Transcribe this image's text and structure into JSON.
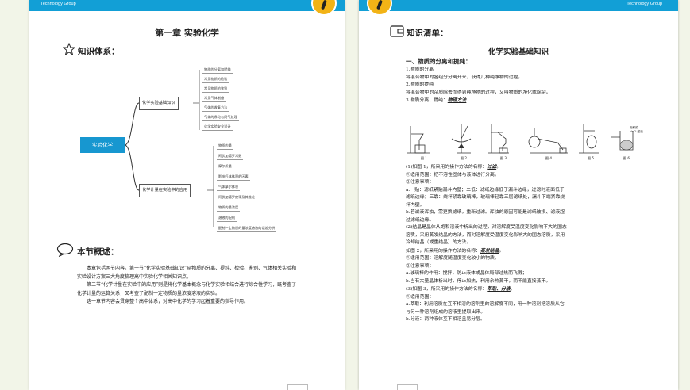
{
  "brand": "Technology Group",
  "left": {
    "chapter_title": "第一章  实验化学",
    "knowledge_heading": "知识体系：",
    "mindmap": {
      "root": "实验化学",
      "branch1": {
        "label": "化学实验基础知识",
        "leaves": [
          "物质的分离和提纯",
          "常见物质的检验",
          "常见物质的鉴别",
          "常见气体制备",
          "气体的收集方法",
          "气体的净化与尾气处理",
          "化学实验安全设计"
        ]
      },
      "branch2": {
        "label": "化学计量在实验中的应用",
        "leaves": [
          "物质的量",
          "阿伏加德罗常数",
          "摩尔质量",
          "影响气体体积的因素",
          "气体摩尔体积",
          "阿伏加德罗定律及其推论",
          "物质的量浓度",
          "溶液的配制",
          "配制一定物质的量浓度溶液的误差分析"
        ]
      }
    },
    "overview_heading": "本节概述：",
    "overview": [
      "本章包括两节内容。第一节“化学实验基础知识”从物质的分离、提纯、检验、鉴别、气体相关实验和实验设计方案三大角度梳理高中实验化学相关知识点。",
      "第二节“化学计量在实验中的应用”则是将化学基本概念与化学实验相结合进行综合性学习，既考查了化学计量的运算关系，又考查了配制一定物质的量浓度溶液的实验。",
      "这一章节内容会贯穿整个高中体系，对高中化学的学习起着重要的指导作用。"
    ]
  },
  "right": {
    "list_heading": "知识清单：",
    "doc_title": "化学实验基础知识",
    "section1": "一、物质的分离和提纯：",
    "lines": [
      "1.物质的分离",
      "将混合物中的各组分分离开来，获得几种纯净物的过程。",
      "2.物质的提纯",
      "将混合物中的杂质除去而得到纯净物的过程，又叫物质的净化或除杂。",
      "3.物质分离、提纯："
    ],
    "method_label": "物理方法",
    "figures": [
      "图 1",
      "图 2",
      "图 3",
      "图 4",
      "图 5",
      "图 6"
    ],
    "fig6_label": "饱和的 NaCl 溶液",
    "fig1_prefix": "(1)如图 1，所采用的操作方法的名称：",
    "fig1_method": "过滤",
    "fig1_lines": [
      "①适用范围：把不溶性固体与液体进行分离。",
      "②注意事项：",
      "a.一贴：滤纸紧贴漏斗内壁；二低：滤纸边缘低于漏斗边缘，过滤时液面低于",
      "滤纸边缘；三靠：烧杯紧靠玻璃棒，玻璃棒轻靠三层滤纸处，漏斗下端紧靠烧",
      "杯内壁。",
      "b.若滤液浑浊，需更换滤纸，重新过滤。浑浊的原因可能是滤纸破损、滤液超",
      "过滤纸边缘。",
      "(2)结晶是晶体从饱和溶液中析出的过程，对溶解度受温度变化影响不大的固态",
      "溶质，采用蒸发结晶的方法，而对溶解度受温度变化影响大的固态溶质，采用",
      "冷却结晶（或重结晶）的方法。"
    ],
    "fig2_prefix": "如图 2，所采用的操作方法的名称：",
    "fig2_method": "蒸发结晶",
    "fig2_lines": [
      "①适用范围：溶解度随温度变化较小的物质。",
      "②注意事项：",
      "a.玻璃棒的作用：搅拌，防止液体或晶体局部过热而飞溅；",
      "b.当有大量晶体析出时，停止加热，利用余热蒸干，而不能直接蒸干。"
    ],
    "fig3_prefix": "(3)如图 3，所采用的操作方法的名称：",
    "fig3_method": "萃取、分液",
    "fig3_lines": [
      "①适用范围：",
      "a.萃取：利用溶质在互不相溶的溶剂里的溶解度不同，用一种溶剂把溶质从它",
      "与另一种溶剂组成的溶液里提取出来。",
      "b.分液：两种液体互不相溶且易分层。"
    ]
  }
}
